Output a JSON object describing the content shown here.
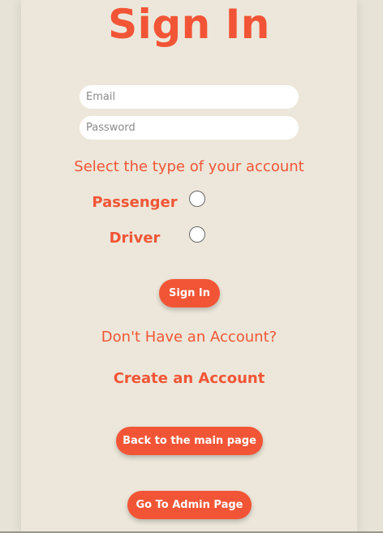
{
  "form": {
    "title": "Sign In",
    "email_placeholder": "Email",
    "password_placeholder": "Password",
    "select_account_label": "Select the type of your account",
    "account_types": [
      {
        "label": "Passenger",
        "selected": false
      },
      {
        "label": "Driver",
        "selected": false
      }
    ],
    "signin_button": "Sign In",
    "no_account_text": "Don't Have an Account?",
    "create_account_link": "Create an Account",
    "main_page_button": "Back to the main page",
    "admin_page_button": "Go To Admin Page"
  },
  "colors": {
    "accent": "#f25536",
    "background": "#e7e3d6",
    "panel": "#ece7da"
  }
}
